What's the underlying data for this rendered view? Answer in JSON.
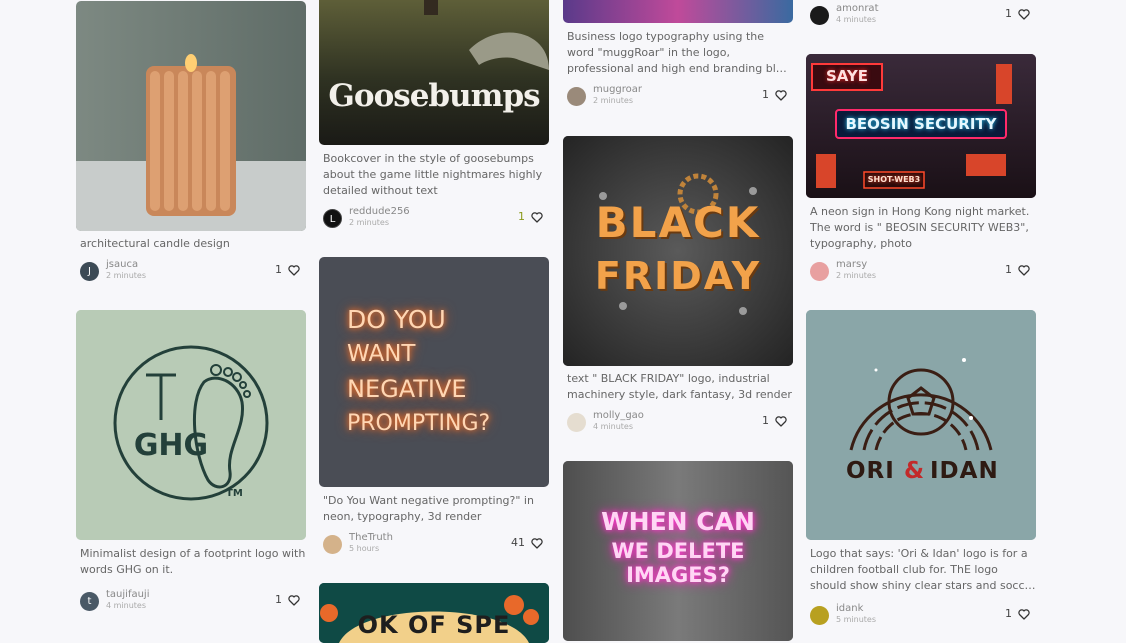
{
  "cards": [
    {
      "img_text": [],
      "caption": "architectural candle design",
      "user": "jsauca",
      "avatar_letter": "J",
      "time": "2 minutes",
      "likes": "1"
    },
    {
      "img_text": [
        "GHG",
        "TM"
      ],
      "caption": "Minimalist design of a footprint logo with words GHG on it.",
      "user": "taujifauji",
      "avatar_letter": "t",
      "time": "4 minutes",
      "likes": "1"
    },
    {
      "img_text": [
        "Goosebumps"
      ],
      "caption": "Bookcover in the style of goosebumps about the game little nightmares highly detailed without text",
      "user": "reddude256",
      "avatar_letter": "L",
      "time": "2 minutes",
      "likes": "1"
    },
    {
      "img_text": [
        "DO YOU",
        "WANT",
        "NEGATIVE",
        "PROMPTING?"
      ],
      "caption": "\"Do You Want negative prompting?\" in neon, typography, 3d render",
      "user": "TheTruth",
      "avatar_letter": "",
      "time": "5 hours",
      "likes": "41"
    },
    {
      "img_text": [
        "OK OF SPE"
      ],
      "caption": "",
      "user": "",
      "avatar_letter": "",
      "time": "",
      "likes": ""
    },
    {
      "img_text": [],
      "caption": "Business logo typography using the word \"muggRoar\" in the logo, professional and high end branding blue purple white...",
      "user": "muggroar",
      "avatar_letter": "",
      "time": "2 minutes",
      "likes": "1"
    },
    {
      "img_text": [
        "BLACK",
        "FRIDAY"
      ],
      "caption": "text \" BLACK FRIDAY\" logo, industrial machinery style, dark fantasy, 3d render",
      "user": "molly_gao",
      "avatar_letter": "",
      "time": "4 minutes",
      "likes": "1"
    },
    {
      "img_text": [
        "WHEN CAN",
        "WE DELETE",
        "IMAGES?"
      ],
      "caption": "",
      "user": "",
      "avatar_letter": "",
      "time": "",
      "likes": ""
    },
    {
      "img_text": [],
      "caption": "",
      "user": "amonrat",
      "avatar_letter": "",
      "time": "4 minutes",
      "likes": "1"
    },
    {
      "img_text": [
        "SAYE",
        "BEOSIN SECURITY",
        "SHOT-WEB3"
      ],
      "caption": "A neon sign in Hong Kong night market. The word is \" BEOSIN SECURITY WEB3\", typography, photo",
      "user": "marsy",
      "avatar_letter": "",
      "time": "2 minutes",
      "likes": "1"
    },
    {
      "img_text": [
        "ORI",
        "&",
        "IDAN"
      ],
      "caption": "Logo that says: 'Ori & Idan' logo is for a children football club for. ThE logo should show shiny clear stars and soccer ball...",
      "user": "idank",
      "avatar_letter": "",
      "time": "5 minutes",
      "likes": "1"
    }
  ],
  "colors": {
    "background": "#f7f7fa",
    "like_accent": "#8a9a1a"
  },
  "icons": {
    "like": "heart-outline-icon"
  }
}
